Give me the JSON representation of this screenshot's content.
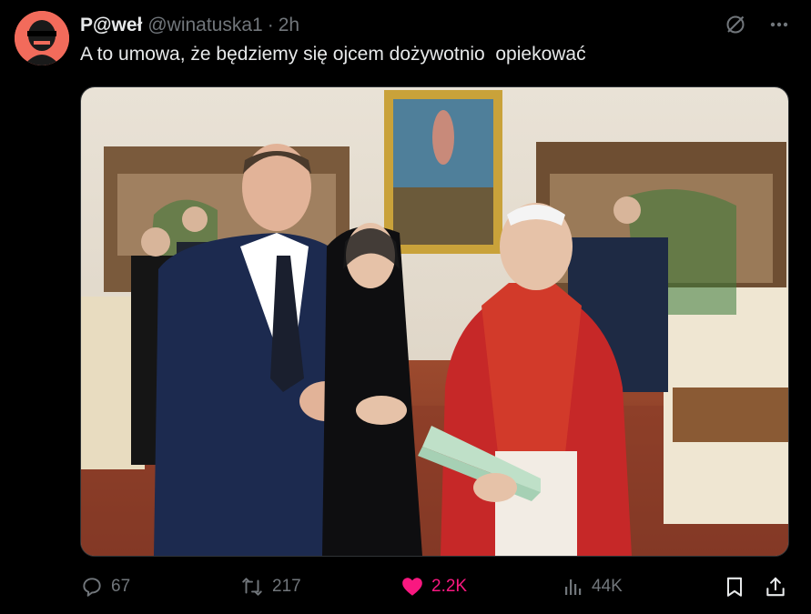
{
  "post": {
    "display_name": "P@weł",
    "handle": "@winatuska1",
    "separator": "·",
    "time": "2h",
    "text": "A to umowa, że będziemy się ojcem dożywotnio  opiekować"
  },
  "metrics": {
    "replies": "67",
    "reposts": "217",
    "likes": "2.2K",
    "views": "44K"
  },
  "icons": {
    "grok": "grok-icon",
    "more": "more-icon",
    "reply": "reply-icon",
    "repost": "repost-icon",
    "like": "heart-icon",
    "views": "views-icon",
    "bookmark": "bookmark-icon",
    "share": "share-icon"
  },
  "colors": {
    "background": "#000000",
    "text": "#e7e9ea",
    "muted": "#71767b",
    "like_active": "#f91880",
    "avatar_bg": "#f26b5b"
  }
}
